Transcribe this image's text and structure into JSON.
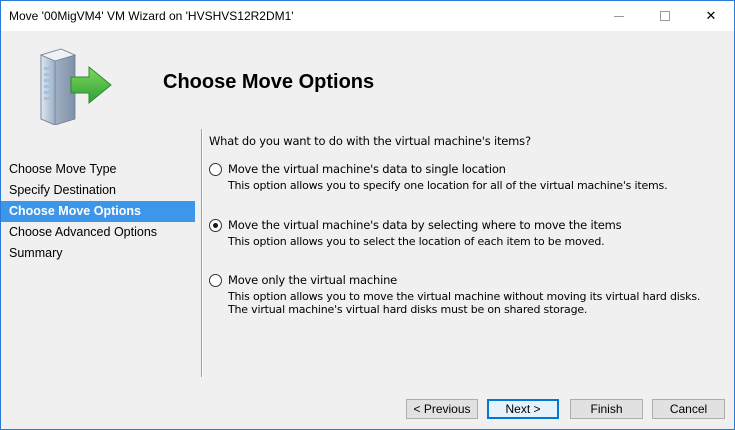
{
  "window": {
    "title": "Move '00MigVM4' VM Wizard on 'HVSHVS12R2DM1'",
    "minimize_glyph": "",
    "close_glyph": "✕"
  },
  "header": {
    "title": "Choose Move Options",
    "icon": "server-move-icon"
  },
  "nav": {
    "items": [
      {
        "label": "Choose Move Type"
      },
      {
        "label": "Specify Destination"
      },
      {
        "label": "Choose Move Options"
      },
      {
        "label": "Choose Advanced Options"
      },
      {
        "label": "Summary"
      }
    ],
    "active_index": 2
  },
  "content": {
    "question": "What do you want to do with the virtual machine's items?",
    "options": [
      {
        "label": "Move the virtual machine's data to single location",
        "description": "This option allows you to specify one location for all of the virtual machine's items.",
        "selected": false
      },
      {
        "label": "Move the virtual machine's data by selecting where to move the items",
        "description": "This option allows you to select the location of each item to be moved.",
        "selected": true
      },
      {
        "label": "Move only the virtual machine",
        "description": "This option allows you to move the virtual machine without moving its virtual hard disks. The virtual machine's virtual hard disks must be on shared storage.",
        "selected": false
      }
    ]
  },
  "buttons": {
    "previous": "< Previous",
    "next": "Next >",
    "finish": "Finish",
    "cancel": "Cancel"
  },
  "colors": {
    "active_nav": "#3c96ea",
    "window_border": "#2b79d7",
    "arrow_green": "#3bb34a"
  }
}
